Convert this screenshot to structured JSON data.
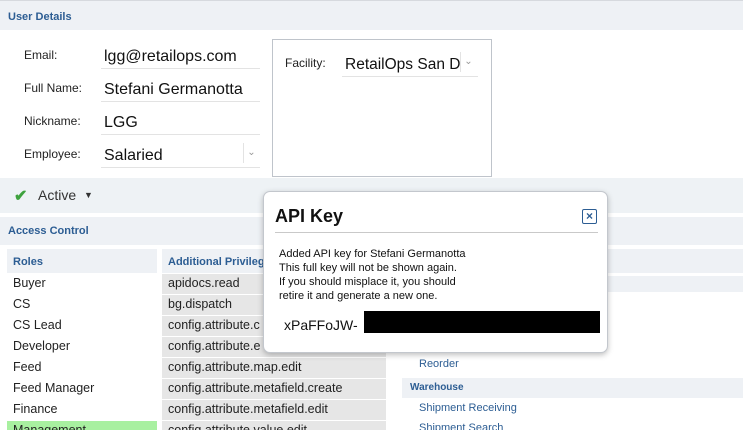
{
  "sections": {
    "user_details": "User Details",
    "access_control": "Access Control"
  },
  "user": {
    "email_label": "Email:",
    "email_value": "lgg@retailops.com",
    "fullname_label": "Full Name:",
    "fullname_value": "Stefani Germanotta",
    "nickname_label": "Nickname:",
    "nickname_value": "LGG",
    "employee_label": "Employee:",
    "employee_value": "Salaried",
    "facility_label": "Facility:",
    "facility_value": "RetailOps San D"
  },
  "status": {
    "label": "Active"
  },
  "roles": {
    "header": "Roles",
    "items": [
      "Buyer",
      "CS",
      "CS Lead",
      "Developer",
      "Feed",
      "Feed Manager",
      "Finance",
      "Management"
    ],
    "selected_index": 7
  },
  "privileges": {
    "header": "Additional Privilege",
    "items": [
      "apidocs.read",
      "bg.dispatch",
      "config.attribute.c",
      "config.attribute.e",
      "config.attribute.map.edit",
      "config.attribute.metafield.create",
      "config.attribute.metafield.edit",
      "config.attribute.value.edit"
    ]
  },
  "right_panel": {
    "reorder": "Reorder",
    "warehouse_group": "Warehouse",
    "shipment_receiving": "Shipment Receiving",
    "shipment_search": "Shipment Search"
  },
  "modal": {
    "title": "API Key",
    "line1": "Added API key for Stefani Germanotta",
    "line2": "This full key will not be shown again.",
    "line3": "If you should misplace it, you should",
    "line4": "retire it and generate a new one.",
    "key_prefix": "xPaFFoJW-"
  },
  "colors": {
    "header_text": "#2c5d93",
    "header_bg": "#eef1f5",
    "selected_role": "#a8f0a0",
    "check": "#3ea23e"
  }
}
